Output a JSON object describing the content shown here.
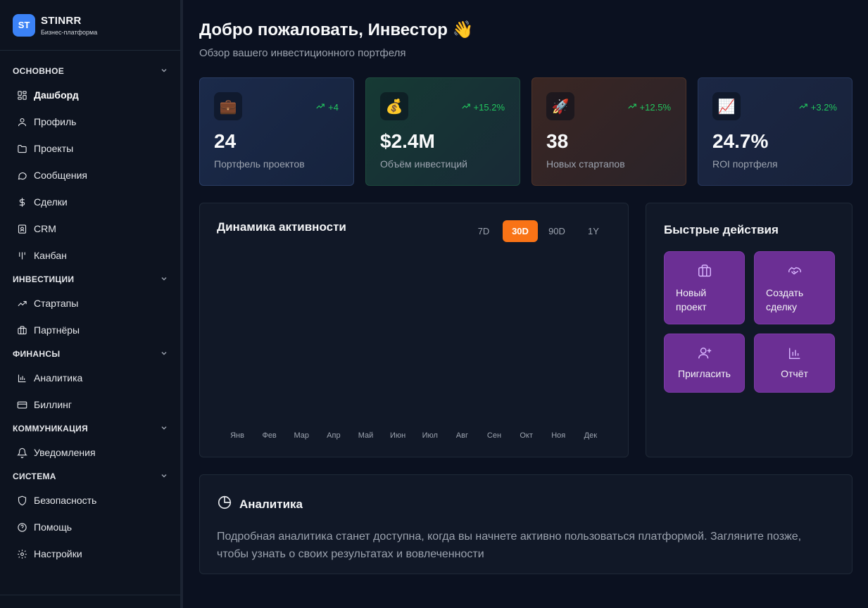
{
  "brand": {
    "logo": "ST",
    "name": "STINRR",
    "subtitle": "Бизнес-платформа"
  },
  "sidebar": {
    "sections": [
      {
        "title": "ОСНОВНОЕ",
        "items": [
          {
            "label": "Дашборд",
            "icon": "dashboard-icon",
            "active": true
          },
          {
            "label": "Профиль",
            "icon": "user-icon"
          },
          {
            "label": "Проекты",
            "icon": "folder-icon"
          },
          {
            "label": "Сообщения",
            "icon": "message-icon"
          },
          {
            "label": "Сделки",
            "icon": "dollar-icon"
          },
          {
            "label": "CRM",
            "icon": "contact-icon"
          },
          {
            "label": "Канбан",
            "icon": "kanban-icon"
          }
        ]
      },
      {
        "title": "ИНВЕСТИЦИИ",
        "items": [
          {
            "label": "Стартапы",
            "icon": "trending-up-icon"
          },
          {
            "label": "Партнёры",
            "icon": "briefcase-icon"
          }
        ]
      },
      {
        "title": "ФИНАНСЫ",
        "items": [
          {
            "label": "Аналитика",
            "icon": "bar-chart-icon"
          },
          {
            "label": "Биллинг",
            "icon": "credit-card-icon"
          }
        ]
      },
      {
        "title": "КОММУНИКАЦИЯ",
        "items": [
          {
            "label": "Уведомления",
            "icon": "bell-icon"
          }
        ]
      },
      {
        "title": "СИСТЕМА",
        "items": [
          {
            "label": "Безопасность",
            "icon": "shield-icon"
          },
          {
            "label": "Помощь",
            "icon": "help-icon"
          },
          {
            "label": "Настройки",
            "icon": "gear-icon"
          }
        ]
      }
    ]
  },
  "header": {
    "title": "Добро пожаловать, Инвестор 👋",
    "subtitle": "Обзор вашего инвестиционного портфеля"
  },
  "stats": [
    {
      "emoji": "💼",
      "icon": "briefcase-emoji-icon",
      "trend": "+4",
      "value": "24",
      "label": "Портфель проектов"
    },
    {
      "emoji": "💰",
      "icon": "money-bag-icon",
      "trend": "+15.2%",
      "value": "$2.4M",
      "label": "Объём инвестиций"
    },
    {
      "emoji": "🚀",
      "icon": "rocket-icon",
      "trend": "+12.5%",
      "value": "38",
      "label": "Новых стартапов"
    },
    {
      "emoji": "📈",
      "icon": "chart-up-icon",
      "trend": "+3.2%",
      "value": "24.7%",
      "label": "ROI портфеля"
    }
  ],
  "activity": {
    "title": "Динамика активности",
    "ranges": [
      "7D",
      "30D",
      "90D",
      "1Y"
    ],
    "active_range": "30D",
    "months": [
      "Янв",
      "Фев",
      "Мар",
      "Апр",
      "Май",
      "Июн",
      "Июл",
      "Авг",
      "Сен",
      "Окт",
      "Ноя",
      "Дек"
    ]
  },
  "quick_actions": {
    "title": "Быстрые действия",
    "items": [
      {
        "line1": "Новый",
        "line2": "проект",
        "icon": "briefcase-icon"
      },
      {
        "line1": "Создать",
        "line2": "сделку",
        "icon": "handshake-icon"
      },
      {
        "label": "Пригласить",
        "icon": "user-plus-icon"
      },
      {
        "label": "Отчёт",
        "icon": "bar-chart-icon"
      }
    ]
  },
  "analytics": {
    "title": "Аналитика",
    "text": "Подробная аналитика станет доступна, когда вы начнете активно пользоваться платформой. Загляните позже, чтобы узнать о своих результатах и вовлеченности"
  },
  "colors": {
    "accent": "#f97316",
    "trend": "#22c55e",
    "action": "#6b2f94",
    "brand": "#3b82f6"
  }
}
